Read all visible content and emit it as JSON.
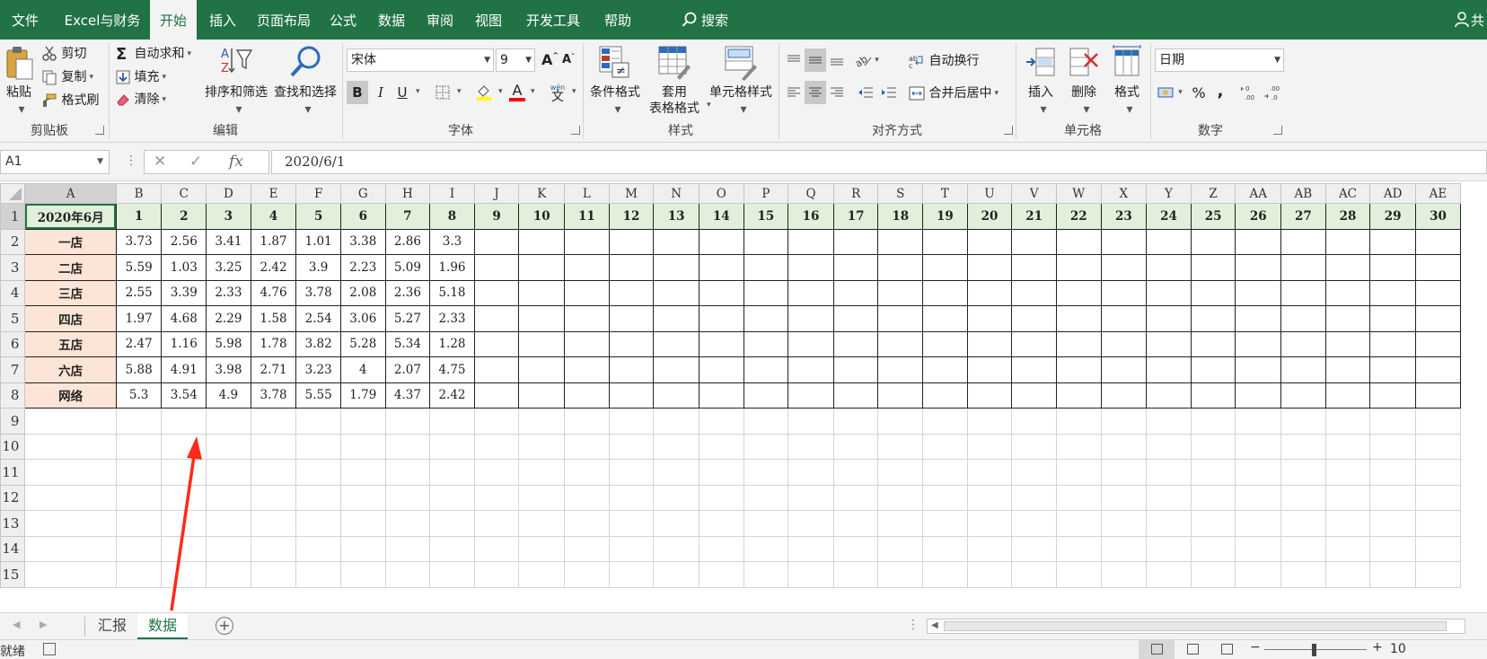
{
  "ribbon_tabs": [
    "文件",
    "Excel与财务",
    "开始",
    "插入",
    "页面布局",
    "公式",
    "数据",
    "审阅",
    "视图",
    "开发工具",
    "帮助"
  ],
  "active_tab": "开始",
  "search_label": "搜索",
  "share_label": "共",
  "clipboard": {
    "paste": "粘贴",
    "cut": "剪切",
    "copy": "复制",
    "format_painter": "格式刷",
    "group": "剪贴板"
  },
  "editing": {
    "autosum": "自动求和",
    "fill": "填充",
    "clear": "清除",
    "sort_filter": "排序和筛选",
    "find_select": "查找和选择",
    "group": "编辑"
  },
  "font": {
    "name": "宋体",
    "size": "9",
    "bold": "B",
    "italic": "I",
    "underline": "U",
    "group": "字体",
    "grow": "A",
    "shrink": "A",
    "color_letter": "A",
    "phonetic": "wén",
    "phonetic_char": "文"
  },
  "styles": {
    "conditional": "条件格式",
    "table_format_1": "套用",
    "table_format_2": "表格格式",
    "cell_styles": "单元格样式",
    "group": "样式"
  },
  "alignment": {
    "wrap": "自动换行",
    "merge": "合并后居中",
    "group": "对齐方式"
  },
  "cells": {
    "insert": "插入",
    "delete": "删除",
    "format": "格式",
    "group": "单元格"
  },
  "number": {
    "format": "日期",
    "percent": "%",
    "comma": ",",
    "group": "数字"
  },
  "name_box": "A1",
  "formula_value": "2020/6/1",
  "columns": [
    "A",
    "B",
    "C",
    "D",
    "E",
    "F",
    "G",
    "H",
    "I",
    "J",
    "K",
    "L",
    "M",
    "N",
    "O",
    "P",
    "Q",
    "R",
    "S",
    "T",
    "U",
    "V",
    "W",
    "X",
    "Y",
    "Z",
    "AA",
    "AB",
    "AC",
    "AD",
    "AE"
  ],
  "row_numbers": [
    "1",
    "2",
    "3",
    "4",
    "5",
    "6",
    "7",
    "8",
    "9",
    "10",
    "11",
    "12",
    "13",
    "14",
    "15"
  ],
  "header_row": [
    "2020年6月",
    "1",
    "2",
    "3",
    "4",
    "5",
    "6",
    "7",
    "8",
    "9",
    "10",
    "11",
    "12",
    "13",
    "14",
    "15",
    "16",
    "17",
    "18",
    "19",
    "20",
    "21",
    "22",
    "23",
    "24",
    "25",
    "26",
    "27",
    "28",
    "29",
    "30"
  ],
  "stores": [
    {
      "name": "一店",
      "values": [
        "3.73",
        "2.56",
        "3.41",
        "1.87",
        "1.01",
        "3.38",
        "2.86",
        "3.3"
      ]
    },
    {
      "name": "二店",
      "values": [
        "5.59",
        "1.03",
        "3.25",
        "2.42",
        "3.9",
        "2.23",
        "5.09",
        "1.96"
      ]
    },
    {
      "name": "三店",
      "values": [
        "2.55",
        "3.39",
        "2.33",
        "4.76",
        "3.78",
        "2.08",
        "2.36",
        "5.18"
      ]
    },
    {
      "name": "四店",
      "values": [
        "1.97",
        "4.68",
        "2.29",
        "1.58",
        "2.54",
        "3.06",
        "5.27",
        "2.33"
      ]
    },
    {
      "name": "五店",
      "values": [
        "2.47",
        "1.16",
        "5.98",
        "1.78",
        "3.82",
        "5.28",
        "5.34",
        "1.28"
      ]
    },
    {
      "name": "六店",
      "values": [
        "5.88",
        "4.91",
        "3.98",
        "2.71",
        "3.23",
        "4",
        "2.07",
        "4.75"
      ]
    },
    {
      "name": "网络",
      "values": [
        "5.3",
        "3.54",
        "4.9",
        "3.78",
        "5.55",
        "1.79",
        "4.37",
        "2.42"
      ]
    }
  ],
  "sheets": [
    "汇报",
    "数据"
  ],
  "active_sheet": "数据",
  "status_text": "就绪",
  "zoom_text": "10",
  "colors": {
    "excel_green": "#217346",
    "header_fill": "#e2efda",
    "store_fill": "#fce4d6",
    "arrow": "#ff2a1a"
  }
}
